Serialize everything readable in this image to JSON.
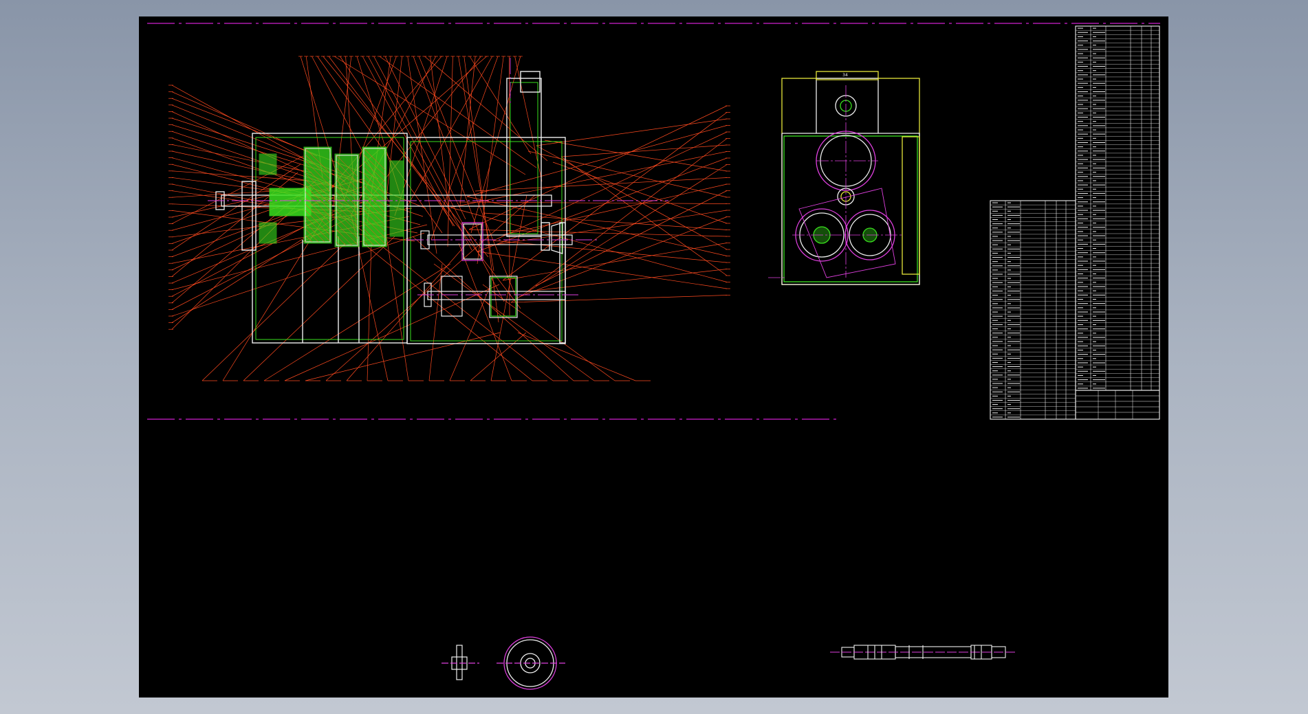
{
  "colors": {
    "viewport_top": "#8995a8",
    "viewport_bottom": "#c2c8d2",
    "sheet": "#000000",
    "leader": "#ff4a1f",
    "centerline": "#e040e0",
    "outline": "#f0f0f0",
    "hatch": "#39e01e",
    "yellow": "#e6e63a",
    "frame_magenta": "#d020d0"
  },
  "icons": {
    "main_view": "gearbox-section-drawing",
    "side_view": "gear-train-end-view",
    "small_part_a": "spur-gear-section",
    "small_part_b": "spur-gear-front",
    "shaft_part": "stepped-shaft-drawing",
    "bom": "parts-list-table"
  },
  "drawing": {
    "dimension_34": "34"
  }
}
